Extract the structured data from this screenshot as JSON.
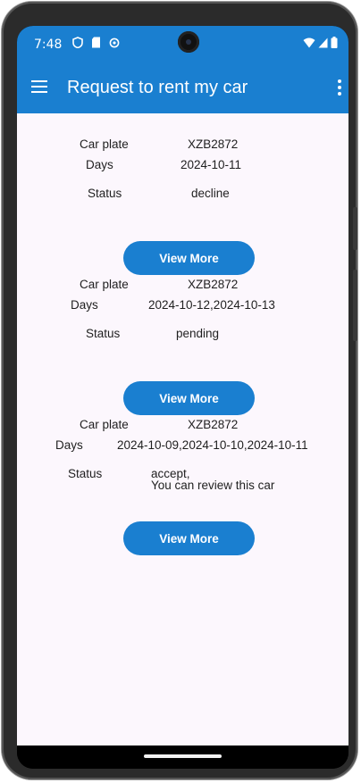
{
  "status_bar": {
    "time": "7:48"
  },
  "app_bar": {
    "title": "Request to rent my car"
  },
  "requests": [
    {
      "car_plate_label": "Car plate",
      "car_plate": "XZB2872",
      "days_label": "Days",
      "days": "2024-10-11",
      "status_label": "Status",
      "status": "decline",
      "button_label": "View More"
    },
    {
      "car_plate_label": "Car plate",
      "car_plate": "XZB2872",
      "days_label": "Days",
      "days": "2024-10-12,2024-10-13",
      "status_label": "Status",
      "status": "pending",
      "button_label": "View More"
    },
    {
      "car_plate_label": "Car plate",
      "car_plate": "XZB2872",
      "days_label": "Days",
      "days": "2024-10-09,2024-10-10,2024-10-11",
      "status_label": "Status",
      "status": "accept,\nYou can review this car",
      "button_label": "View More"
    }
  ],
  "colors": {
    "primary": "#1a7fd0",
    "background": "#fcf7fd"
  }
}
